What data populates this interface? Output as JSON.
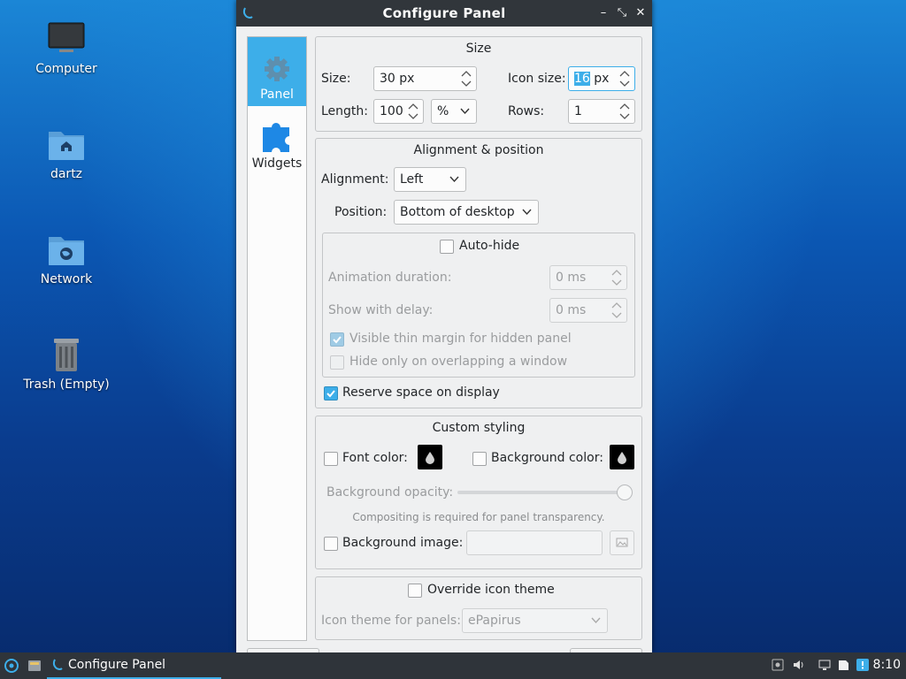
{
  "desktop": {
    "icons": [
      {
        "label": "Computer",
        "icon": "monitor-icon"
      },
      {
        "label": "dartz",
        "icon": "home-folder-icon"
      },
      {
        "label": "Network",
        "icon": "network-folder-icon"
      },
      {
        "label": "Trash (Empty)",
        "icon": "trash-icon"
      }
    ]
  },
  "window": {
    "title": "Configure Panel",
    "buttons": {
      "minimize": "–",
      "restore": "⤡",
      "close": "✕"
    }
  },
  "sidebar": {
    "items": [
      {
        "label": "Panel",
        "icon": "gear-icon",
        "active": true
      },
      {
        "label": "Widgets",
        "icon": "puzzle-icon",
        "active": false
      }
    ]
  },
  "size_group": {
    "title": "Size",
    "size_label": "Size:",
    "size_value": "30 px",
    "icon_size_label": "Icon size:",
    "icon_size_number": "16",
    "icon_size_unit": " px",
    "length_label": "Length:",
    "length_value": "100",
    "length_unit": "%",
    "rows_label": "Rows:",
    "rows_value": "1"
  },
  "alignment_group": {
    "title": "Alignment & position",
    "alignment_label": "Alignment:",
    "alignment_value": "Left",
    "position_label": "Position:",
    "position_value": "Bottom of desktop",
    "autohide_label": "Auto-hide",
    "animation_label": "Animation duration:",
    "animation_value": "0 ms",
    "delay_label": "Show with delay:",
    "delay_value": "0 ms",
    "thin_margin_label": "Visible thin margin for hidden panel",
    "overlap_label": "Hide only on overlapping a window",
    "reserve_label": "Reserve space on display"
  },
  "styling_group": {
    "title": "Custom styling",
    "font_color_label": "Font color:",
    "bg_color_label": "Background color:",
    "opacity_label": "Background opacity:",
    "opacity_value": 1.0,
    "compositing_note": "Compositing is required for panel transparency.",
    "bg_image_label": "Background image:"
  },
  "icon_theme_group": {
    "override_label": "Override icon theme",
    "theme_label": "Icon theme for panels:",
    "theme_value": "ePapirus"
  },
  "taskbar": {
    "task_label": "Configure Panel",
    "clock": "8:10"
  },
  "colors": {
    "accent": "#3daee9",
    "titlebar": "#31363b",
    "window_bg": "#eff0f1"
  }
}
